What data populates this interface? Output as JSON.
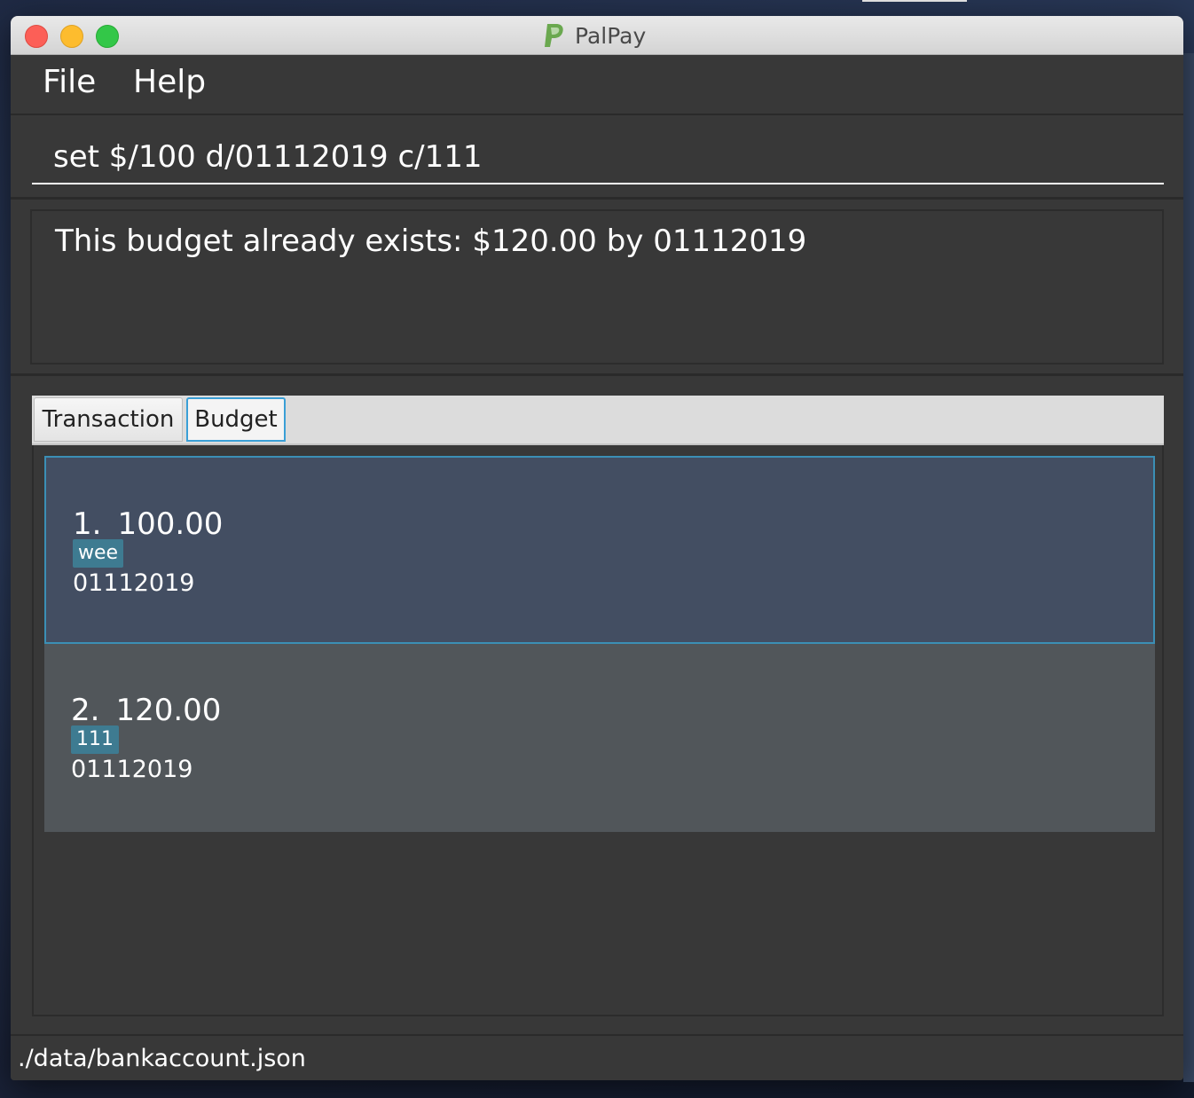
{
  "window": {
    "title": "PalPay"
  },
  "menu": {
    "items": [
      "File",
      "Help"
    ]
  },
  "command": {
    "value": "set $/100 d/01112019 c/111"
  },
  "result": {
    "message": "This budget already exists: $120.00 by 01112019"
  },
  "tabs": {
    "items": [
      {
        "label": "Transaction",
        "selected": false
      },
      {
        "label": "Budget",
        "selected": true
      }
    ]
  },
  "budgets": [
    {
      "index": "1.",
      "amount": "100.00",
      "tag": "wee",
      "date": "01112019",
      "selected": true
    },
    {
      "index": "2.",
      "amount": "120.00",
      "tag": "111",
      "date": "01112019",
      "selected": false
    }
  ],
  "status": {
    "file_path": "./data/bankaccount.json"
  },
  "colors": {
    "accent": "#3a9fd6",
    "tag_bg": "#3e7b91",
    "selected_card": "#434e62",
    "card": "#51565a",
    "logo_green": "#6aa84f"
  },
  "icons": {
    "logo": "palpay-logo-icon"
  }
}
